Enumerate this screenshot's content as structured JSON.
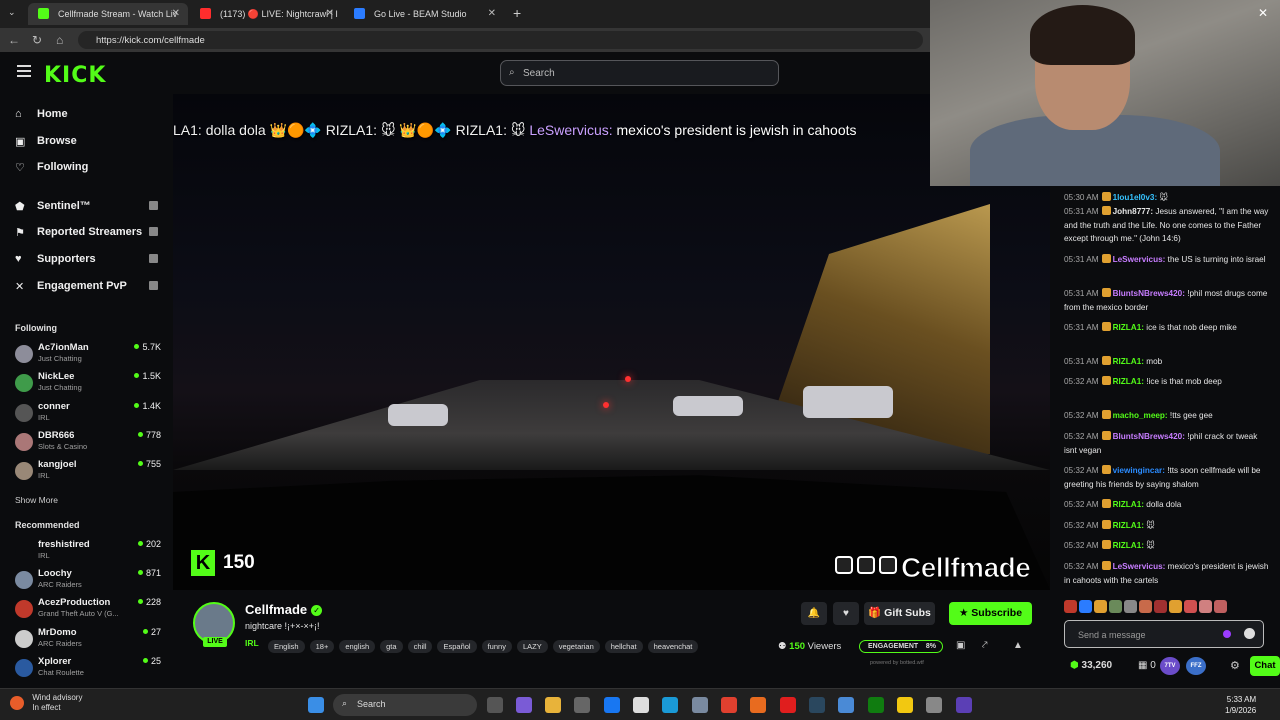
{
  "browser": {
    "tabs": [
      {
        "title": "Cellfmade Stream - Watch Liv",
        "color": "#53fc18",
        "active": true
      },
      {
        "title": "(1173) 🔴 LIVE: Nightcrawl | I",
        "color": "#ff2d2d",
        "active": false
      },
      {
        "title": "Go Live - BEAM Studio",
        "color": "#2b7cff",
        "active": false
      }
    ],
    "url": "https://kick.com/cellfmade"
  },
  "header": {
    "logo": "KICK",
    "search_placeholder": "Search"
  },
  "sidebar": {
    "nav": [
      {
        "label": "Home",
        "icon": "home-icon"
      },
      {
        "label": "Browse",
        "icon": "browse-icon"
      },
      {
        "label": "Following",
        "icon": "heart-icon"
      }
    ],
    "extensions": [
      {
        "label": "Sentinel™",
        "icon": "shield-icon"
      },
      {
        "label": "Reported Streamers",
        "icon": "flag-icon"
      },
      {
        "label": "Supporters",
        "icon": "heart-icon"
      },
      {
        "label": "Engagement PvP",
        "icon": "swords-icon"
      }
    ],
    "following_title": "Following",
    "following": [
      {
        "name": "Ac7ionMan",
        "category": "Just Chatting",
        "viewers": "5.7K",
        "color": "#8d8d9a"
      },
      {
        "name": "NickLee",
        "category": "Just Chatting",
        "viewers": "1.5K",
        "color": "#3f9b4a"
      },
      {
        "name": "conner",
        "category": "IRL",
        "viewers": "1.4K",
        "color": "#555"
      },
      {
        "name": "DBR666",
        "category": "Slots & Casino",
        "viewers": "778",
        "color": "#a77"
      },
      {
        "name": "kangjoel",
        "category": "IRL",
        "viewers": "755",
        "color": "#998877"
      }
    ],
    "show_more": "Show More",
    "recommended_title": "Recommended",
    "recommended": [
      {
        "name": "freshistired",
        "category": "IRL",
        "viewers": "202",
        "color": "#0b0c0e"
      },
      {
        "name": "Loochy",
        "category": "ARC Raiders",
        "viewers": "871",
        "color": "#7a8aa0"
      },
      {
        "name": "AcezProduction",
        "category": "Grand Theft Auto V (G...",
        "viewers": "228",
        "color": "#c0392b"
      },
      {
        "name": "MrDomo",
        "category": "ARC Raiders",
        "viewers": "27",
        "color": "#ccc"
      },
      {
        "name": "Xplorer",
        "category": "Chat Roulette",
        "viewers": "25",
        "color": "#2a5aa0"
      }
    ]
  },
  "video": {
    "ticker_pre": "LA1: dolla dola 👑🟠💠 RIZLA1: 🐭 👑🟠💠 RIZLA1: 🐭 ",
    "ticker_user": "LeSwervicus:",
    "ticker_msg": " mexico's president is jewish in cahoots",
    "viewer_badge": "150",
    "watermark": "Cellfmade"
  },
  "chat": {
    "messages": [
      {
        "time": "05:30 AM",
        "user": "1lou1el0v3:",
        "color": "#36c3ff",
        "text": " 🐭"
      },
      {
        "time": "05:31 AM",
        "user": "John8777:",
        "color": "#e6e6e6",
        "text": " Jesus answered, \"I am the way and the truth and the Life. No one comes to the Father except through me.\" (John 14:6)"
      },
      {
        "time": "05:31 AM",
        "user": "LeSwervicus:",
        "color": "#c77dff",
        "text": " the US is turning into israel"
      },
      {
        "time": "05:31 AM",
        "user": "BluntsNBrews420:",
        "color": "#c77dff",
        "text": " !phil most drugs come from the mexico border"
      },
      {
        "time": "05:31 AM",
        "user": "RIZLA1:",
        "color": "#53fc18",
        "text": " ice is that nob deep mike"
      },
      {
        "time": "05:31 AM",
        "user": "RIZLA1:",
        "color": "#53fc18",
        "text": " mob"
      },
      {
        "time": "05:32 AM",
        "user": "RIZLA1:",
        "color": "#53fc18",
        "text": " !ice is that mob deep"
      },
      {
        "time": "05:32 AM",
        "user": "macho_meep:",
        "color": "#53fc18",
        "text": " !tts gee gee"
      },
      {
        "time": "05:32 AM",
        "user": "BluntsNBrews420:",
        "color": "#c77dff",
        "text": " !phil crack or tweak isnt vegan"
      },
      {
        "time": "05:32 AM",
        "user": "viewingincar:",
        "color": "#2b8cff",
        "text": " !tts soon cellfmade will be greeting his friends by saying shalom"
      },
      {
        "time": "05:32 AM",
        "user": "RIZLA1:",
        "color": "#53fc18",
        "text": " dolla dola"
      },
      {
        "time": "05:32 AM",
        "user": "RIZLA1:",
        "color": "#53fc18",
        "text": " 🐭"
      },
      {
        "time": "05:32 AM",
        "user": "RIZLA1:",
        "color": "#53fc18",
        "text": " 🐭"
      },
      {
        "time": "05:32 AM",
        "user": "LeSwervicus:",
        "color": "#c77dff",
        "text": " mexico's president is jewish in cahoots with the cartels"
      }
    ],
    "input_placeholder": "Send a message",
    "points": "33,260",
    "zero_count": "0",
    "pills": [
      "7TV",
      "FFZ"
    ],
    "chat_button": "Chat"
  },
  "channel": {
    "name": "Cellfmade",
    "live_badge": "LIVE",
    "title": "nightcare !¡+×-×+¡!",
    "category": "IRL",
    "tags": [
      "English",
      "18+",
      "english",
      "gta",
      "chill",
      "Español",
      "funny",
      "LAZY",
      "vegetarian",
      "hellchat",
      "heavenchat"
    ],
    "gift_label": "Gift Subs",
    "subscribe_label": "Subscribe",
    "viewers_count": "150",
    "viewers_label": "Viewers",
    "engagement_label": "ENGAGEMENT",
    "engagement_pct": "8%",
    "powered_by": "powered by botted.wtf"
  },
  "taskbar": {
    "weather_title": "Wind advisory",
    "weather_sub": "In effect",
    "search": "Search",
    "time": "5:33 AM",
    "date": "1/9/2026"
  }
}
